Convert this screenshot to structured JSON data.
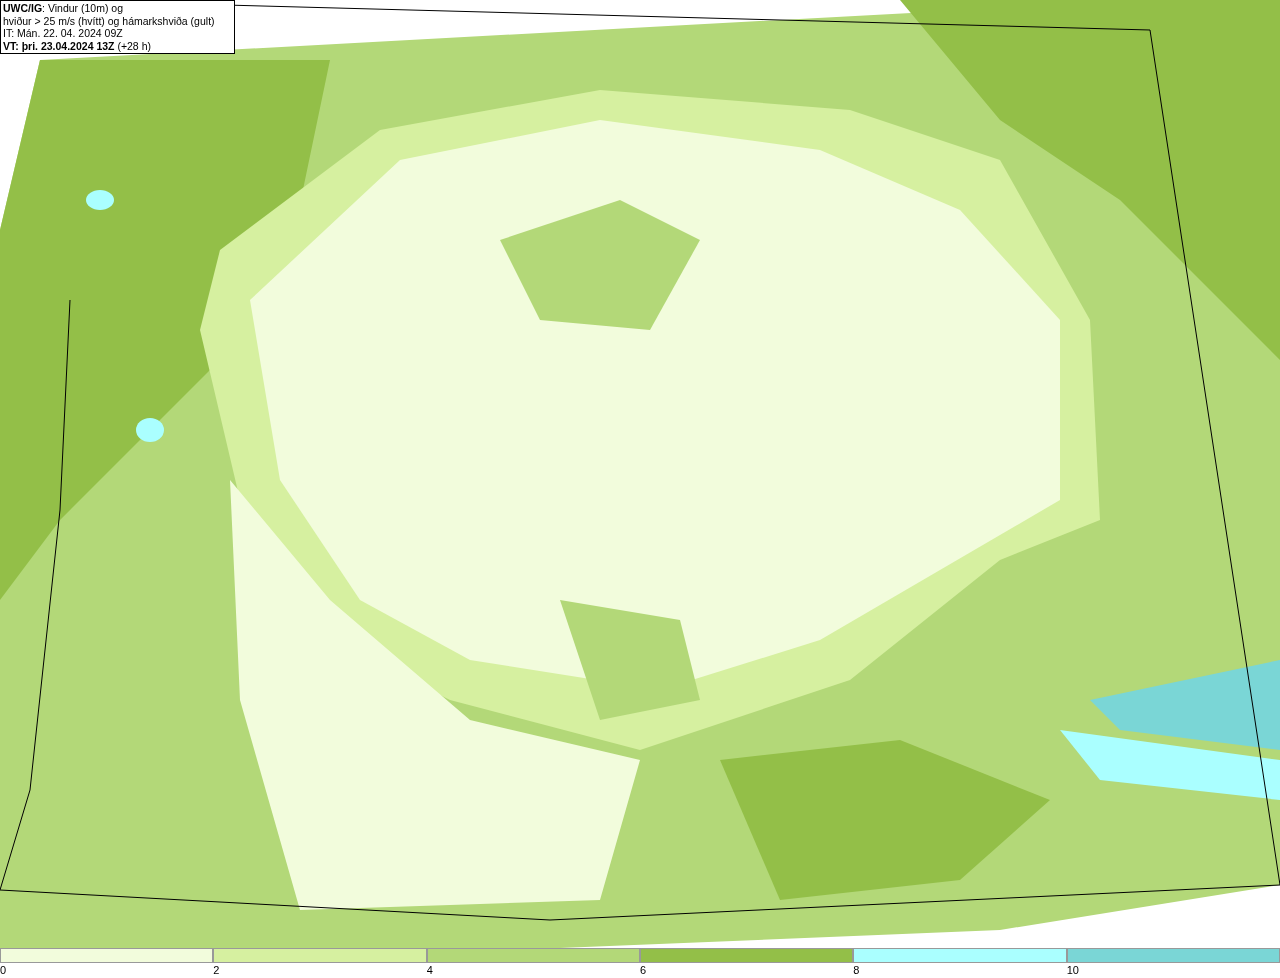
{
  "header": {
    "lines": [
      "**UWC/IG**: Vindur (10m) og",
      "hviður > 25 m/s (hvítt) og hámarkshviða (gult)",
      "IT: Mán. 22. 04. 2024 09Z",
      "**VT: þri. 23.04.2024 13Z** (+28 h)"
    ]
  },
  "legend": [
    {
      "label": "0",
      "color": "#f2fcdc"
    },
    {
      "label": "2",
      "color": "#d6f0a0"
    },
    {
      "label": "4",
      "color": "#b3d878"
    },
    {
      "label": "6",
      "color": "#93bf48"
    },
    {
      "label": "8",
      "color": "#aaffff"
    },
    {
      "label": "10",
      "color": "#7ad6d6"
    }
  ]
}
